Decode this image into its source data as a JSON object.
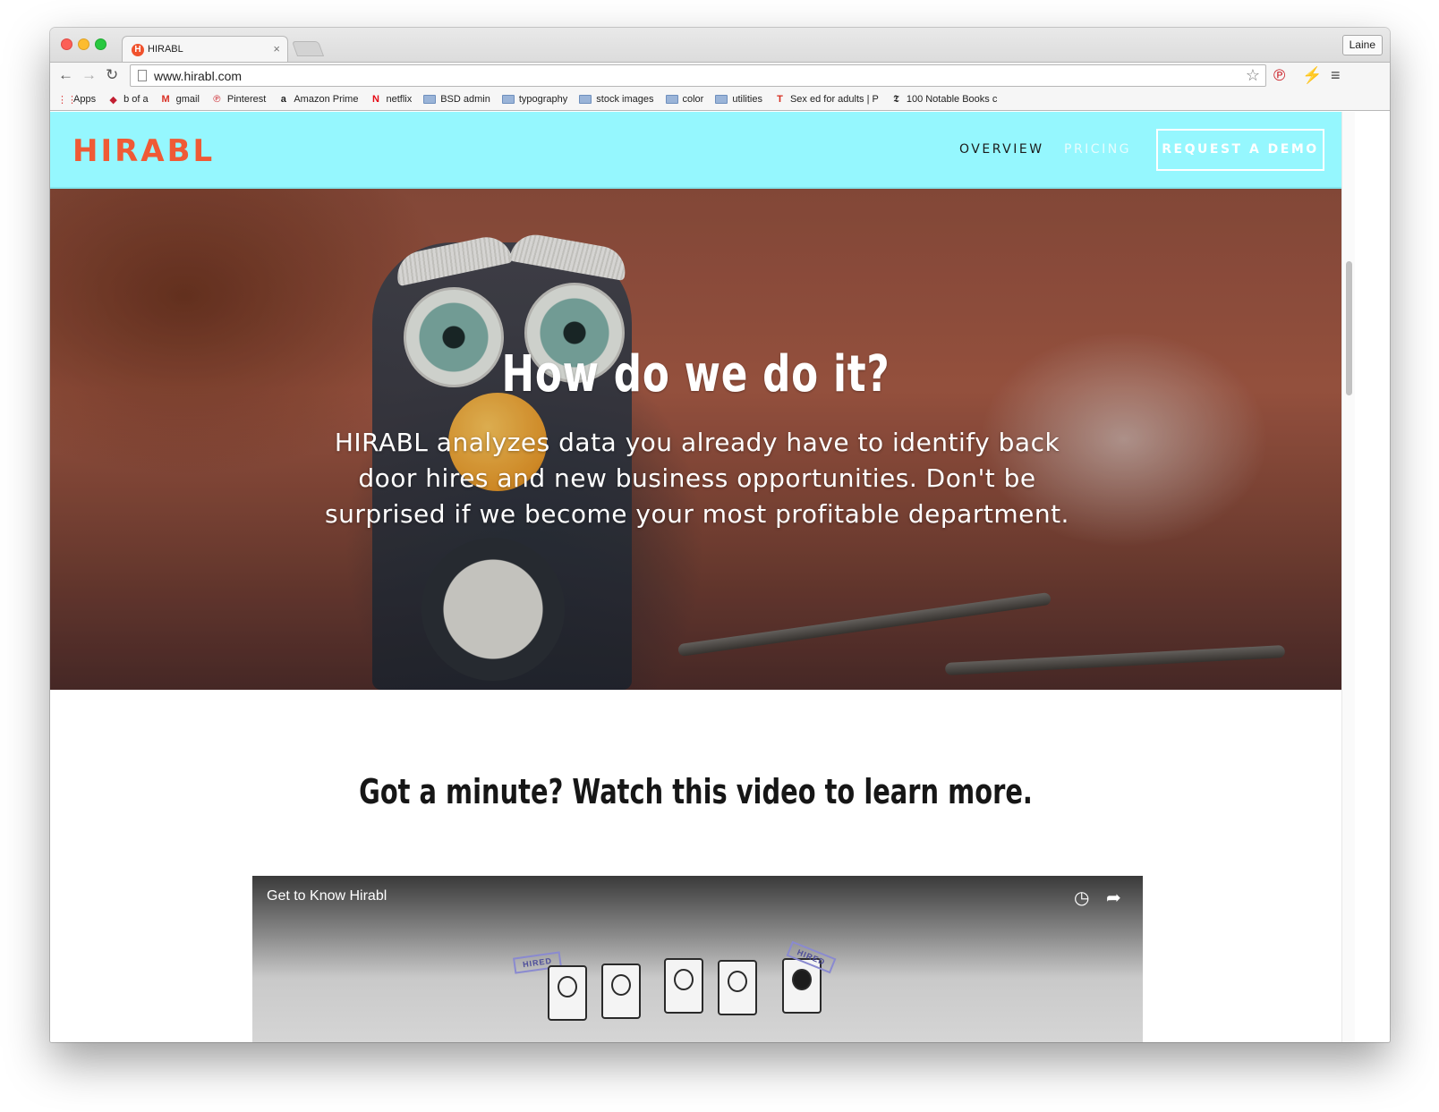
{
  "browser": {
    "tab_title": "HIRABL",
    "tab_favicon": "H",
    "tab_close": "×",
    "profile_name": "Laine",
    "url": "www.hirabl.com",
    "icons": {
      "back": "←",
      "forward": "→",
      "reload": "↻",
      "star": "☆",
      "pinterest": "℗",
      "extension": "⚡",
      "menu": "≡"
    }
  },
  "bookmarks": [
    {
      "icon": "apps-icon",
      "glyph": "⋮⋮",
      "label": "Apps"
    },
    {
      "icon": "bank-icon",
      "glyph": "◆",
      "label": "b of a"
    },
    {
      "icon": "gmail-icon",
      "glyph": "M",
      "label": "gmail"
    },
    {
      "icon": "pinterest-icon",
      "glyph": "℗",
      "label": "Pinterest"
    },
    {
      "icon": "amazon-icon",
      "glyph": "a",
      "label": "Amazon Prime"
    },
    {
      "icon": "netflix-icon",
      "glyph": "N",
      "label": "netflix"
    },
    {
      "icon": "folder-icon",
      "glyph": "",
      "label": "BSD admin"
    },
    {
      "icon": "folder-icon",
      "glyph": "",
      "label": "typography"
    },
    {
      "icon": "folder-icon",
      "glyph": "",
      "label": "stock images"
    },
    {
      "icon": "folder-icon",
      "glyph": "",
      "label": "color"
    },
    {
      "icon": "folder-icon",
      "glyph": "",
      "label": "utilities"
    },
    {
      "icon": "tumblr-icon",
      "glyph": "T",
      "label": "Sex ed for adults | P"
    },
    {
      "icon": "nyt-icon",
      "glyph": "𝕿",
      "label": "100 Notable Books c"
    }
  ],
  "site": {
    "logo": "HIRABL",
    "nav": {
      "overview": "OVERVIEW",
      "pricing": "PRICING",
      "demo": "REQUEST A DEMO"
    },
    "hero": {
      "title": "How do we do it?",
      "subtitle": "HIRABL analyzes data you already have to identify back door hires and new business opportunities. Don't be surprised if we become your most profitable department."
    },
    "video_section": {
      "heading": "Got a minute? Watch this video to learn more.",
      "video_title": "Get to Know Hirabl",
      "stamp_left": "HIRED",
      "stamp_right": "HIRED",
      "icon_clock": "◷",
      "icon_share": "➦"
    }
  },
  "colors": {
    "header_bg": "#95f7fe",
    "logo": "#ef5a35",
    "pricing_link": "#e7fcfe",
    "heading_text": "#161616"
  }
}
